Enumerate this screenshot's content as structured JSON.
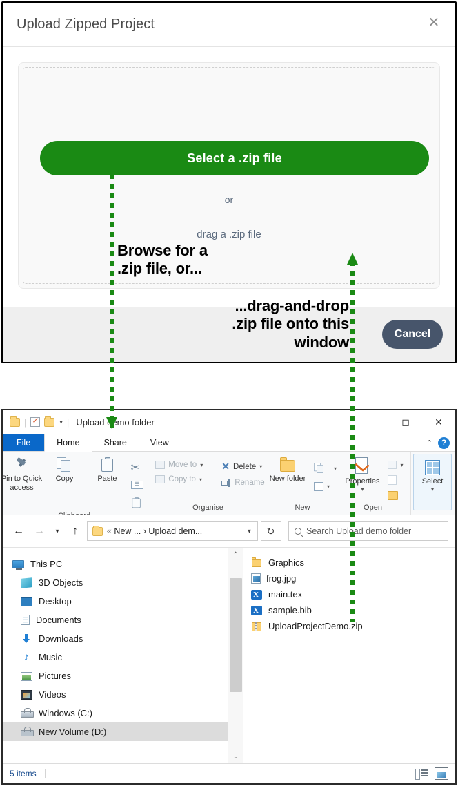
{
  "dialog": {
    "title": "Upload Zipped Project",
    "close_icon": "close-icon",
    "select_button_label": "Select a .zip file",
    "or_label": "or",
    "drag_label": "drag a .zip file",
    "cancel_label": "Cancel",
    "button_color": "#1a8a14",
    "cancel_color": "#47556b"
  },
  "annotations": {
    "browse": "Browse for a\n.zip file, or...",
    "drag": "...drag-and-drop\n.zip file onto this\nwindow",
    "arrow_color": "#1a8a14"
  },
  "explorer": {
    "titlebar": {
      "title": "Upload demo folder",
      "quick_access_icons": [
        "folder-icon",
        "checkbox-icon",
        "folder-icon"
      ],
      "dropdown_caret": "▾",
      "minimize": "—",
      "maximize": "☐",
      "close": "✕"
    },
    "tabs": [
      {
        "label": "File",
        "style": "file"
      },
      {
        "label": "Home",
        "style": "active"
      },
      {
        "label": "Share",
        "style": "normal"
      },
      {
        "label": "View",
        "style": "normal"
      }
    ],
    "tabs_right": {
      "collapse_caret": "⌃",
      "help_label": "?"
    },
    "ribbon": {
      "groups": [
        {
          "label": "Clipboard",
          "big_buttons": [
            {
              "label": "Pin to Quick\naccess",
              "icon": "pin-icon",
              "dim": false
            },
            {
              "label": "Copy",
              "icon": "copy-icon",
              "dim": false
            },
            {
              "label": "Paste",
              "icon": "paste-icon",
              "dim": false
            }
          ],
          "small_buttons": [
            {
              "label": "",
              "icon": "cut-icon",
              "dim": false
            },
            {
              "label": "",
              "icon": "copy-path-icon",
              "dim": false
            },
            {
              "label": "",
              "icon": "paste-shortcut-icon",
              "dim": false
            }
          ]
        },
        {
          "label": "Organise",
          "small_buttons": [
            {
              "label": "Move to",
              "icon": "move-to-icon",
              "dim": true,
              "caret": "▾"
            },
            {
              "label": "Copy to",
              "icon": "copy-to-icon",
              "dim": true,
              "caret": "▾"
            },
            {
              "label": "Delete",
              "icon": "delete-icon",
              "dim": false,
              "caret": "▾"
            },
            {
              "label": "Rename",
              "icon": "rename-icon",
              "dim": true
            }
          ]
        },
        {
          "label": "New",
          "big_buttons": [
            {
              "label": "New\nfolder",
              "icon": "new-folder-icon",
              "dim": false
            }
          ]
        },
        {
          "label": "Open",
          "big_buttons": [
            {
              "label": "Properties",
              "icon": "properties-icon",
              "dim": false,
              "caret": "▾"
            }
          ]
        },
        {
          "label": "",
          "big_buttons": [
            {
              "label": "Select",
              "icon": "select-icon",
              "dim": false,
              "caret": "▾"
            }
          ]
        }
      ]
    },
    "address": {
      "back_icon": "back-arrow-icon",
      "forward_icon": "forward-arrow-icon",
      "recent_icon": "recent-locations-icon",
      "up_icon": "up-arrow-icon",
      "path": "« New ...  ›  Upload dem...",
      "dropdown_caret": "⌄",
      "refresh_icon": "↻",
      "search_placeholder": "Search Upload demo folder",
      "search_icon": "search-icon"
    },
    "navpane": {
      "items": [
        {
          "label": "This PC",
          "icon": "this-pc-icon",
          "root": true,
          "selected": false
        },
        {
          "label": "3D Objects",
          "icon": "3d-objects-icon",
          "root": false,
          "selected": false
        },
        {
          "label": "Desktop",
          "icon": "desktop-icon",
          "root": false,
          "selected": false
        },
        {
          "label": "Documents",
          "icon": "documents-icon",
          "root": false,
          "selected": false
        },
        {
          "label": "Downloads",
          "icon": "downloads-icon",
          "root": false,
          "selected": false
        },
        {
          "label": "Music",
          "icon": "music-icon",
          "root": false,
          "selected": false
        },
        {
          "label": "Pictures",
          "icon": "pictures-icon",
          "root": false,
          "selected": false
        },
        {
          "label": "Videos",
          "icon": "videos-icon",
          "root": false,
          "selected": false
        },
        {
          "label": "Windows (C:)",
          "icon": "drive-icon",
          "root": false,
          "selected": false
        },
        {
          "label": "New Volume (D:)",
          "icon": "drive-icon",
          "root": false,
          "selected": true
        }
      ],
      "scroll_up": "⌃",
      "scroll_down": "⌄"
    },
    "files": [
      {
        "name": "Graphics",
        "icon": "folder-icon"
      },
      {
        "name": "frog.jpg",
        "icon": "image-file-icon"
      },
      {
        "name": "main.tex",
        "icon": "tex-file-icon"
      },
      {
        "name": "sample.bib",
        "icon": "tex-file-icon"
      },
      {
        "name": "UploadProjectDemo.zip",
        "icon": "zip-file-icon"
      }
    ],
    "status": {
      "item_count": "5 items",
      "view_details_icon": "details-view-icon",
      "view_large_icon": "large-icons-view-icon"
    }
  }
}
